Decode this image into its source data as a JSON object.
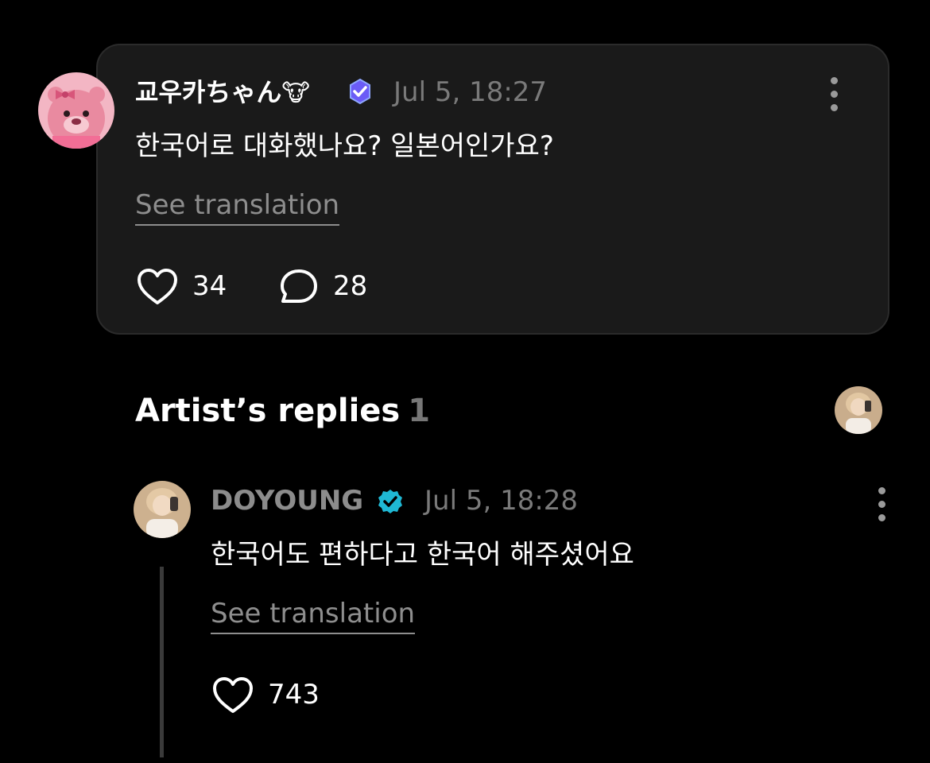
{
  "comment": {
    "username": "교우카ちゃん",
    "name_emoji": "🐮",
    "timestamp": "Jul 5, 18:27",
    "text": "한국어로 대화했나요? 일본어인가요?",
    "see_translation": "See translation",
    "likes": "34",
    "replies": "28"
  },
  "artist_replies": {
    "title": "Artist’s replies",
    "count": "1"
  },
  "reply": {
    "username": "DOYOUNG",
    "timestamp": "Jul 5, 18:28",
    "text": "한국어도 편하다고 한국어 해주셨어요",
    "see_translation": "See translation",
    "likes": "743"
  },
  "colors": {
    "background": "#000000",
    "card": "#1a1a1a",
    "fan_badge": "#6b5cf6",
    "artist_badge": "#1fb8d4",
    "muted_text": "#7a7a7a"
  }
}
